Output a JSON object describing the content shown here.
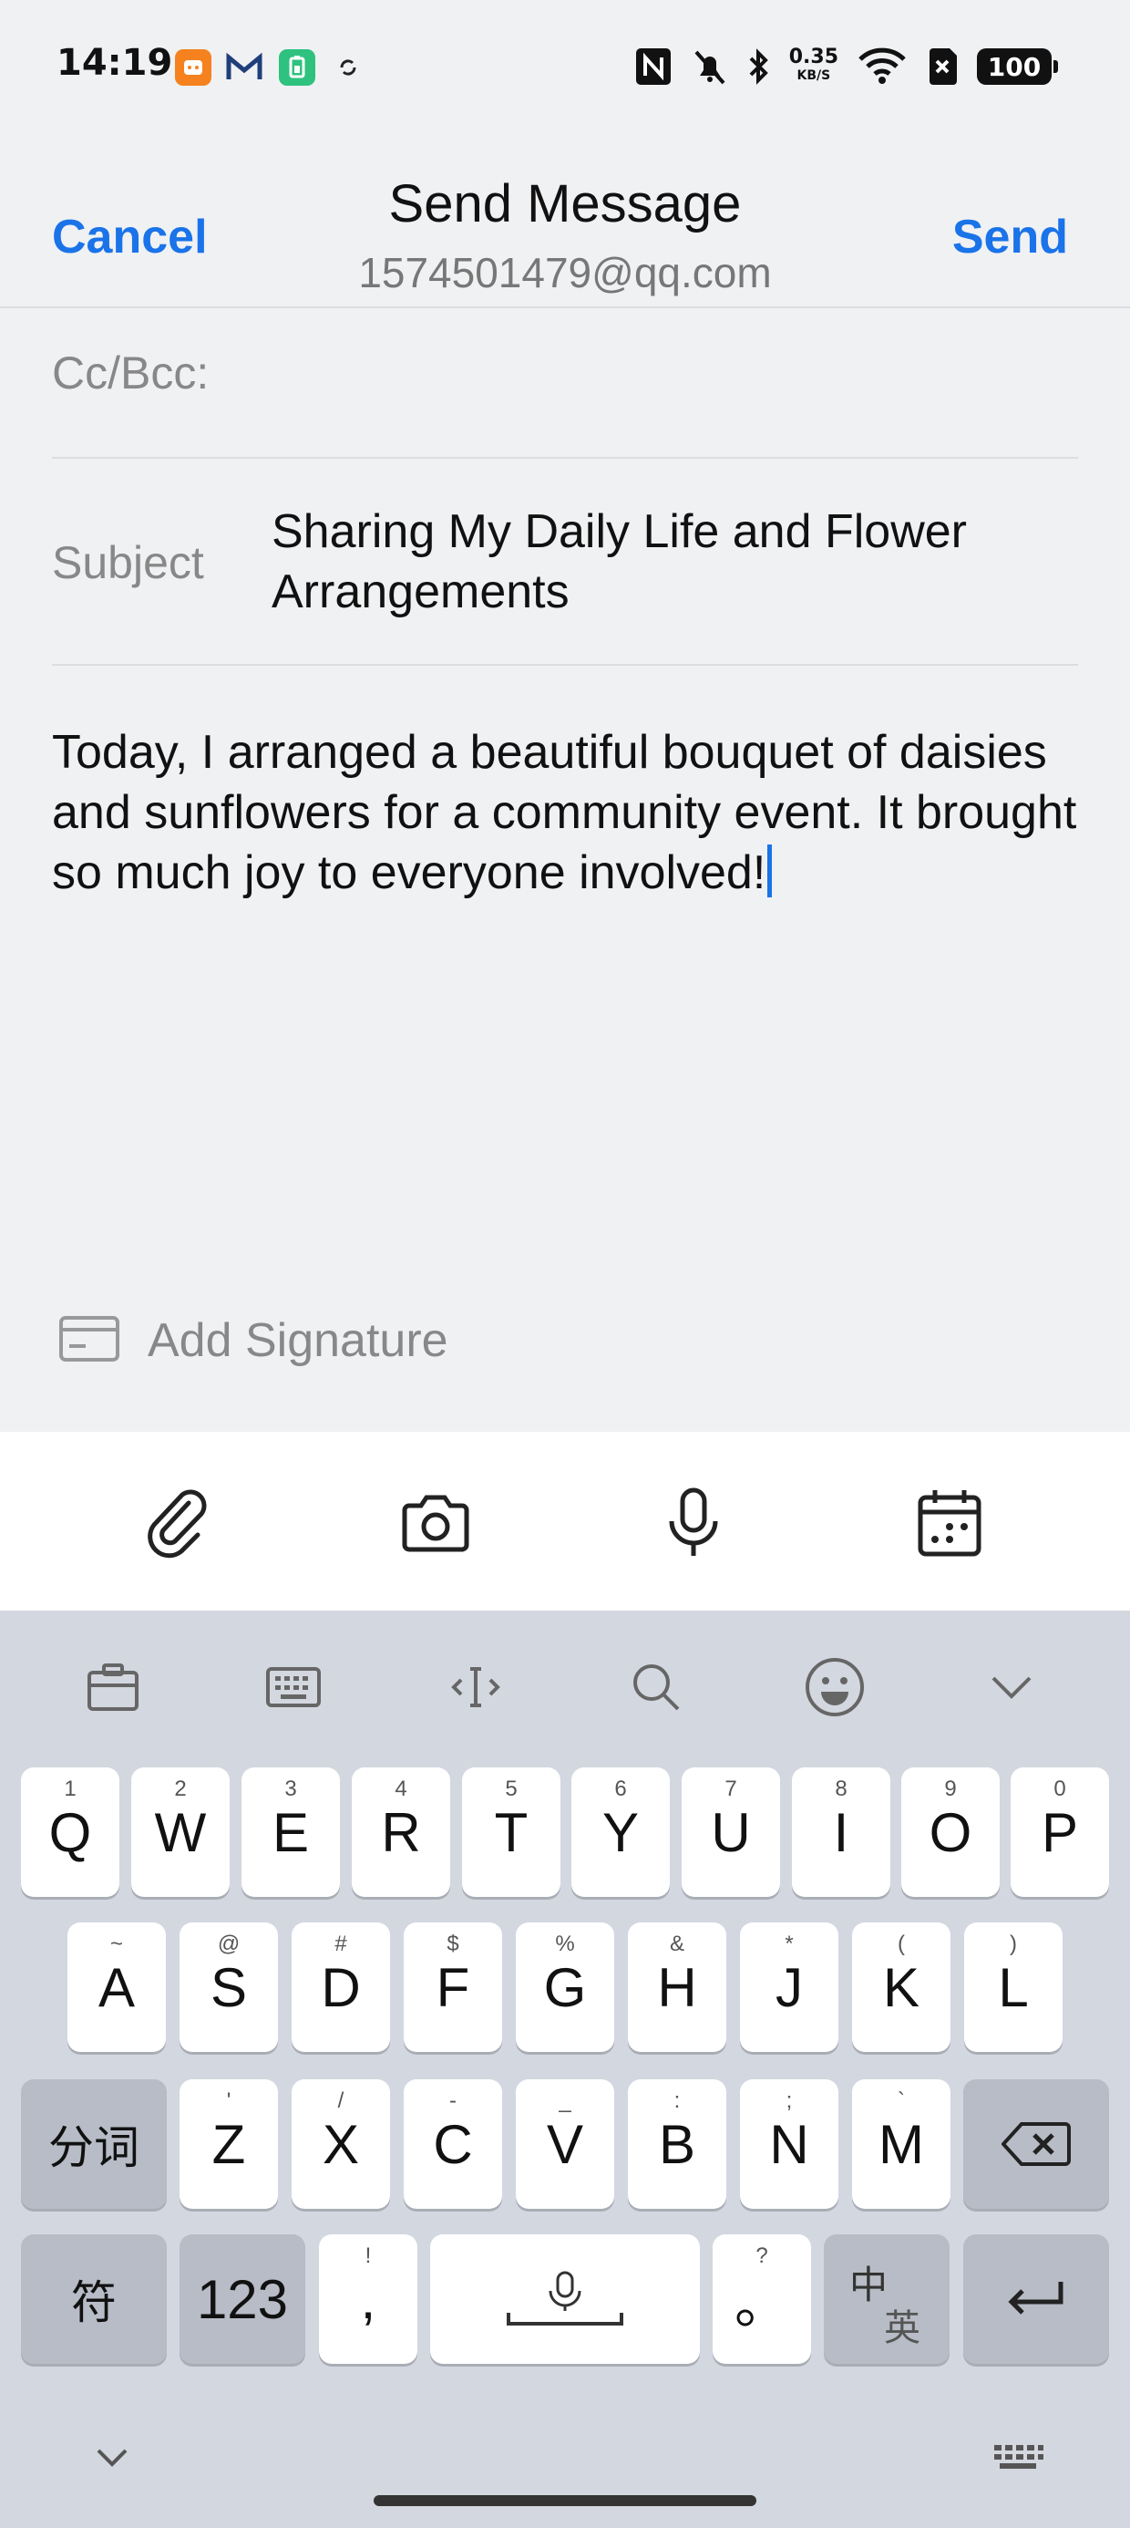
{
  "status_bar": {
    "time": "14:19",
    "net_speed": "0.35",
    "net_unit": "KB/S",
    "battery": "100",
    "colors": {
      "app1": "#f5821f",
      "app3": "#2ec27e"
    }
  },
  "header": {
    "cancel_label": "Cancel",
    "title": "Send Message",
    "account": "1574501479@qq.com",
    "send_label": "Send",
    "accent": "#1a73e8"
  },
  "compose": {
    "ccbcc_label": "Cc/Bcc:",
    "subject_label": "Subject",
    "subject_value": "Sharing My Daily Life and Flower Arrangements",
    "body": "Today, I arranged a beautiful bouquet of daisies and sunflowers for a community event. It brought so much joy to everyone involved!",
    "signature_label": "Add Signature"
  },
  "attach_bar": {
    "icons": [
      "paperclip-icon",
      "camera-icon",
      "microphone-icon",
      "calendar-icon"
    ]
  },
  "keyboard": {
    "toolbar_icons": [
      "clipboard-icon",
      "keyboard-layout-icon",
      "cursor-move-icon",
      "search-icon",
      "emoji-icon",
      "collapse-icon"
    ],
    "row1": [
      {
        "key": "Q",
        "sub": "1"
      },
      {
        "key": "W",
        "sub": "2"
      },
      {
        "key": "E",
        "sub": "3"
      },
      {
        "key": "R",
        "sub": "4"
      },
      {
        "key": "T",
        "sub": "5"
      },
      {
        "key": "Y",
        "sub": "6"
      },
      {
        "key": "U",
        "sub": "7"
      },
      {
        "key": "I",
        "sub": "8"
      },
      {
        "key": "O",
        "sub": "9"
      },
      {
        "key": "P",
        "sub": "0"
      }
    ],
    "row2": [
      {
        "key": "A",
        "sub": "~"
      },
      {
        "key": "S",
        "sub": "@"
      },
      {
        "key": "D",
        "sub": "#"
      },
      {
        "key": "F",
        "sub": "$"
      },
      {
        "key": "G",
        "sub": "%"
      },
      {
        "key": "H",
        "sub": "&"
      },
      {
        "key": "J",
        "sub": "*"
      },
      {
        "key": "K",
        "sub": "("
      },
      {
        "key": "L",
        "sub": ")"
      }
    ],
    "row3_left": "分词",
    "row3": [
      {
        "key": "Z",
        "sub": "'"
      },
      {
        "key": "X",
        "sub": "/"
      },
      {
        "key": "C",
        "sub": "-"
      },
      {
        "key": "V",
        "sub": "_"
      },
      {
        "key": "B",
        "sub": ":"
      },
      {
        "key": "N",
        "sub": ";"
      },
      {
        "key": "M",
        "sub": "`"
      }
    ],
    "symbol_key": "符",
    "num_key": "123",
    "comma_key": ",",
    "comma_sub": "!",
    "period_key": "。",
    "period_sub": "?",
    "lang_key_top": "中",
    "lang_key_bottom": "英"
  }
}
